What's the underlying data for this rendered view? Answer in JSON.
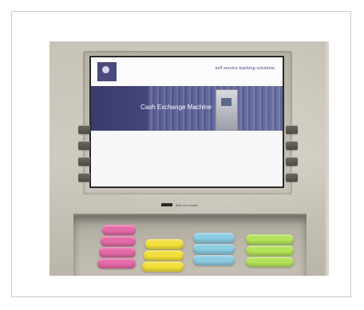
{
  "screen": {
    "tagline": "self service banking solutions",
    "title": "Cash Exchange Machine",
    "side_text": "",
    "slot_label": "Bitte den Rollen"
  },
  "tray": {
    "colors": [
      "#e46aa7",
      "#f2df3a",
      "#8ccbe2",
      "#b4e25a"
    ]
  }
}
